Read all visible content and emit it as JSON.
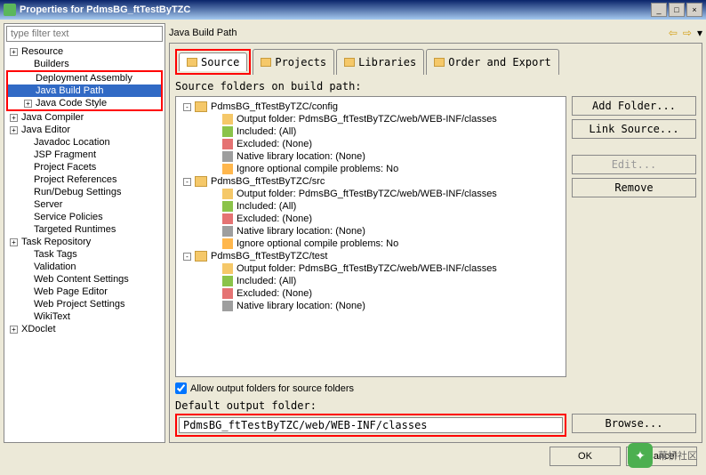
{
  "window": {
    "title": "Properties for PdmsBG_ftTestByTZC",
    "min": "_",
    "max": "□",
    "close": "×"
  },
  "filter_placeholder": "type filter text",
  "sidebar": [
    {
      "label": "Resource",
      "level": 1,
      "exp": "+"
    },
    {
      "label": "Builders",
      "level": 2
    },
    {
      "label": "Deployment Assembly",
      "level": 2
    },
    {
      "label": "Java Build Path",
      "level": 2,
      "selected": true
    },
    {
      "label": "Java Code Style",
      "level": 2,
      "exp": "+"
    },
    {
      "label": "Java Compiler",
      "level": 1,
      "exp": "+"
    },
    {
      "label": "Java Editor",
      "level": 1,
      "exp": "+"
    },
    {
      "label": "Javadoc Location",
      "level": 2
    },
    {
      "label": "JSP Fragment",
      "level": 2
    },
    {
      "label": "Project Facets",
      "level": 2
    },
    {
      "label": "Project References",
      "level": 2
    },
    {
      "label": "Run/Debug Settings",
      "level": 2
    },
    {
      "label": "Server",
      "level": 2
    },
    {
      "label": "Service Policies",
      "level": 2
    },
    {
      "label": "Targeted Runtimes",
      "level": 2
    },
    {
      "label": "Task Repository",
      "level": 1,
      "exp": "+"
    },
    {
      "label": "Task Tags",
      "level": 2
    },
    {
      "label": "Validation",
      "level": 2
    },
    {
      "label": "Web Content Settings",
      "level": 2
    },
    {
      "label": "Web Page Editor",
      "level": 2
    },
    {
      "label": "Web Project Settings",
      "level": 2
    },
    {
      "label": "WikiText",
      "level": 2
    },
    {
      "label": "XDoclet",
      "level": 1,
      "exp": "+"
    }
  ],
  "heading": "Java Build Path",
  "nav": {
    "back": "⇦",
    "fwd": "⇨",
    "menu": "▾"
  },
  "tabs": [
    {
      "label": "Source",
      "active": true
    },
    {
      "label": "Projects"
    },
    {
      "label": "Libraries"
    },
    {
      "label": "Order and Export"
    }
  ],
  "subhead": "Source folders on build path:",
  "source_tree": [
    {
      "exp": "-",
      "icon": "folder",
      "label": "PdmsBG_ftTestByTZC/config",
      "d": 0
    },
    {
      "icon": "out",
      "label": "Output folder: PdmsBG_ftTestByTZC/web/WEB-INF/classes",
      "d": 2
    },
    {
      "icon": "inc",
      "label": "Included: (All)",
      "d": 2
    },
    {
      "icon": "exc",
      "label": "Excluded: (None)",
      "d": 2
    },
    {
      "icon": "nat",
      "label": "Native library location: (None)",
      "d": 2
    },
    {
      "icon": "ign",
      "label": "Ignore optional compile problems: No",
      "d": 2
    },
    {
      "exp": "-",
      "icon": "folder",
      "label": "PdmsBG_ftTestByTZC/src",
      "d": 0
    },
    {
      "icon": "out",
      "label": "Output folder: PdmsBG_ftTestByTZC/web/WEB-INF/classes",
      "d": 2
    },
    {
      "icon": "inc",
      "label": "Included: (All)",
      "d": 2
    },
    {
      "icon": "exc",
      "label": "Excluded: (None)",
      "d": 2
    },
    {
      "icon": "nat",
      "label": "Native library location: (None)",
      "d": 2
    },
    {
      "icon": "ign",
      "label": "Ignore optional compile problems: No",
      "d": 2
    },
    {
      "exp": "-",
      "icon": "folder",
      "label": "PdmsBG_ftTestByTZC/test",
      "d": 0
    },
    {
      "icon": "out",
      "label": "Output folder: PdmsBG_ftTestByTZC/web/WEB-INF/classes",
      "d": 2
    },
    {
      "icon": "inc",
      "label": "Included: (All)",
      "d": 2
    },
    {
      "icon": "exc",
      "label": "Excluded: (None)",
      "d": 2
    },
    {
      "icon": "nat",
      "label": "Native library location: (None)",
      "d": 2
    }
  ],
  "buttons": {
    "add_folder": "Add Folder...",
    "link_source": "Link Source...",
    "edit": "Edit...",
    "remove": "Remove",
    "browse": "Browse..."
  },
  "allow_label": "Allow output folders for source folders",
  "allow_checked": true,
  "default_label": "Default output folder:",
  "default_value": "PdmsBG_ftTestByTZC/web/WEB-INF/classes",
  "footer": {
    "ok": "OK",
    "cancel": "Cancel"
  },
  "watermark": "幕桥社区"
}
